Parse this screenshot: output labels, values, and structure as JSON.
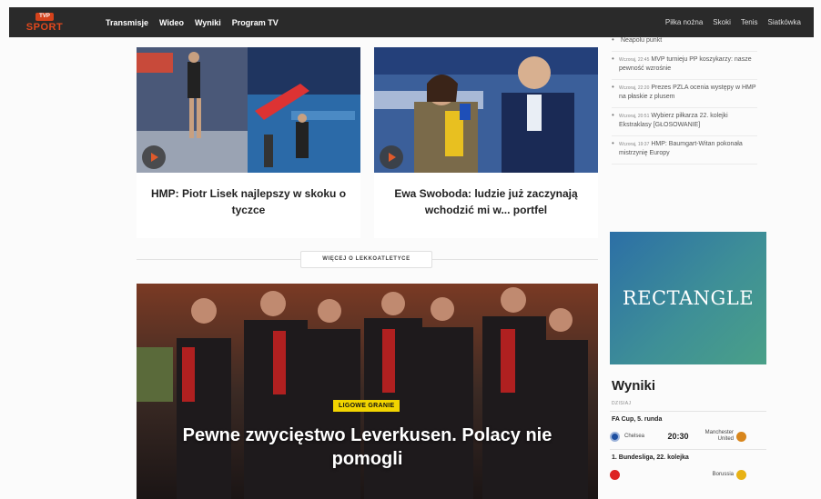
{
  "brand": {
    "logo_top": "TVP",
    "logo_main": "SPORT"
  },
  "nav": {
    "left": [
      "Transmisje",
      "Wideo",
      "Wyniki",
      "Program TV"
    ],
    "right": [
      "Piłka nożna",
      "Skoki",
      "Tenis",
      "Siatkówka"
    ]
  },
  "cards": [
    {
      "title": "HMP: Piotr Lisek najlepszy w skoku o tyczce"
    },
    {
      "title": "Ewa Swoboda: ludzie już zaczynają wchodzić mi w... portfel"
    }
  ],
  "more_button": "WIĘCEJ O LEKKOATLETYCE",
  "hero": {
    "tag": "LIGOWE GRANIE",
    "title": "Pewne zwycięstwo Leverkusen. Polacy nie pomogli"
  },
  "news": [
    {
      "time": "",
      "text": "Neapolu punkt"
    },
    {
      "time": "Wczoraj, 22:45",
      "text": "MVP turnieju PP koszykarzy: nasze pewność wzrośnie"
    },
    {
      "time": "Wczoraj, 22:20",
      "text": "Prezes PZLA ocenia występy w HMP na płaskie z plusem"
    },
    {
      "time": "Wczoraj, 20:51",
      "text": "Wybierz piłkarza 22. kolejki Ekstraklasy [GŁOSOWANIE]"
    },
    {
      "time": "Wczoraj, 19:37",
      "text": "HMP: Baumgart-Witan pokonała mistrzynię Europy"
    }
  ],
  "ad": {
    "label": "RECTANGLE"
  },
  "scores": {
    "title": "Wyniki",
    "subhead": "DZISIAJ",
    "groups": [
      {
        "league": "FA Cup, 5. runda",
        "matches": [
          {
            "home": "Chelsea",
            "score": "20:30",
            "away": "Manchester United",
            "home_color": "#1d4fa0",
            "away_color": "#d8861c"
          }
        ]
      },
      {
        "league": "1. Bundesliga, 22. kolejka",
        "matches": [
          {
            "home": "",
            "score": "",
            "away": "Borussia",
            "home_color": "#d22",
            "away_color": "#e8b215"
          }
        ]
      }
    ]
  }
}
